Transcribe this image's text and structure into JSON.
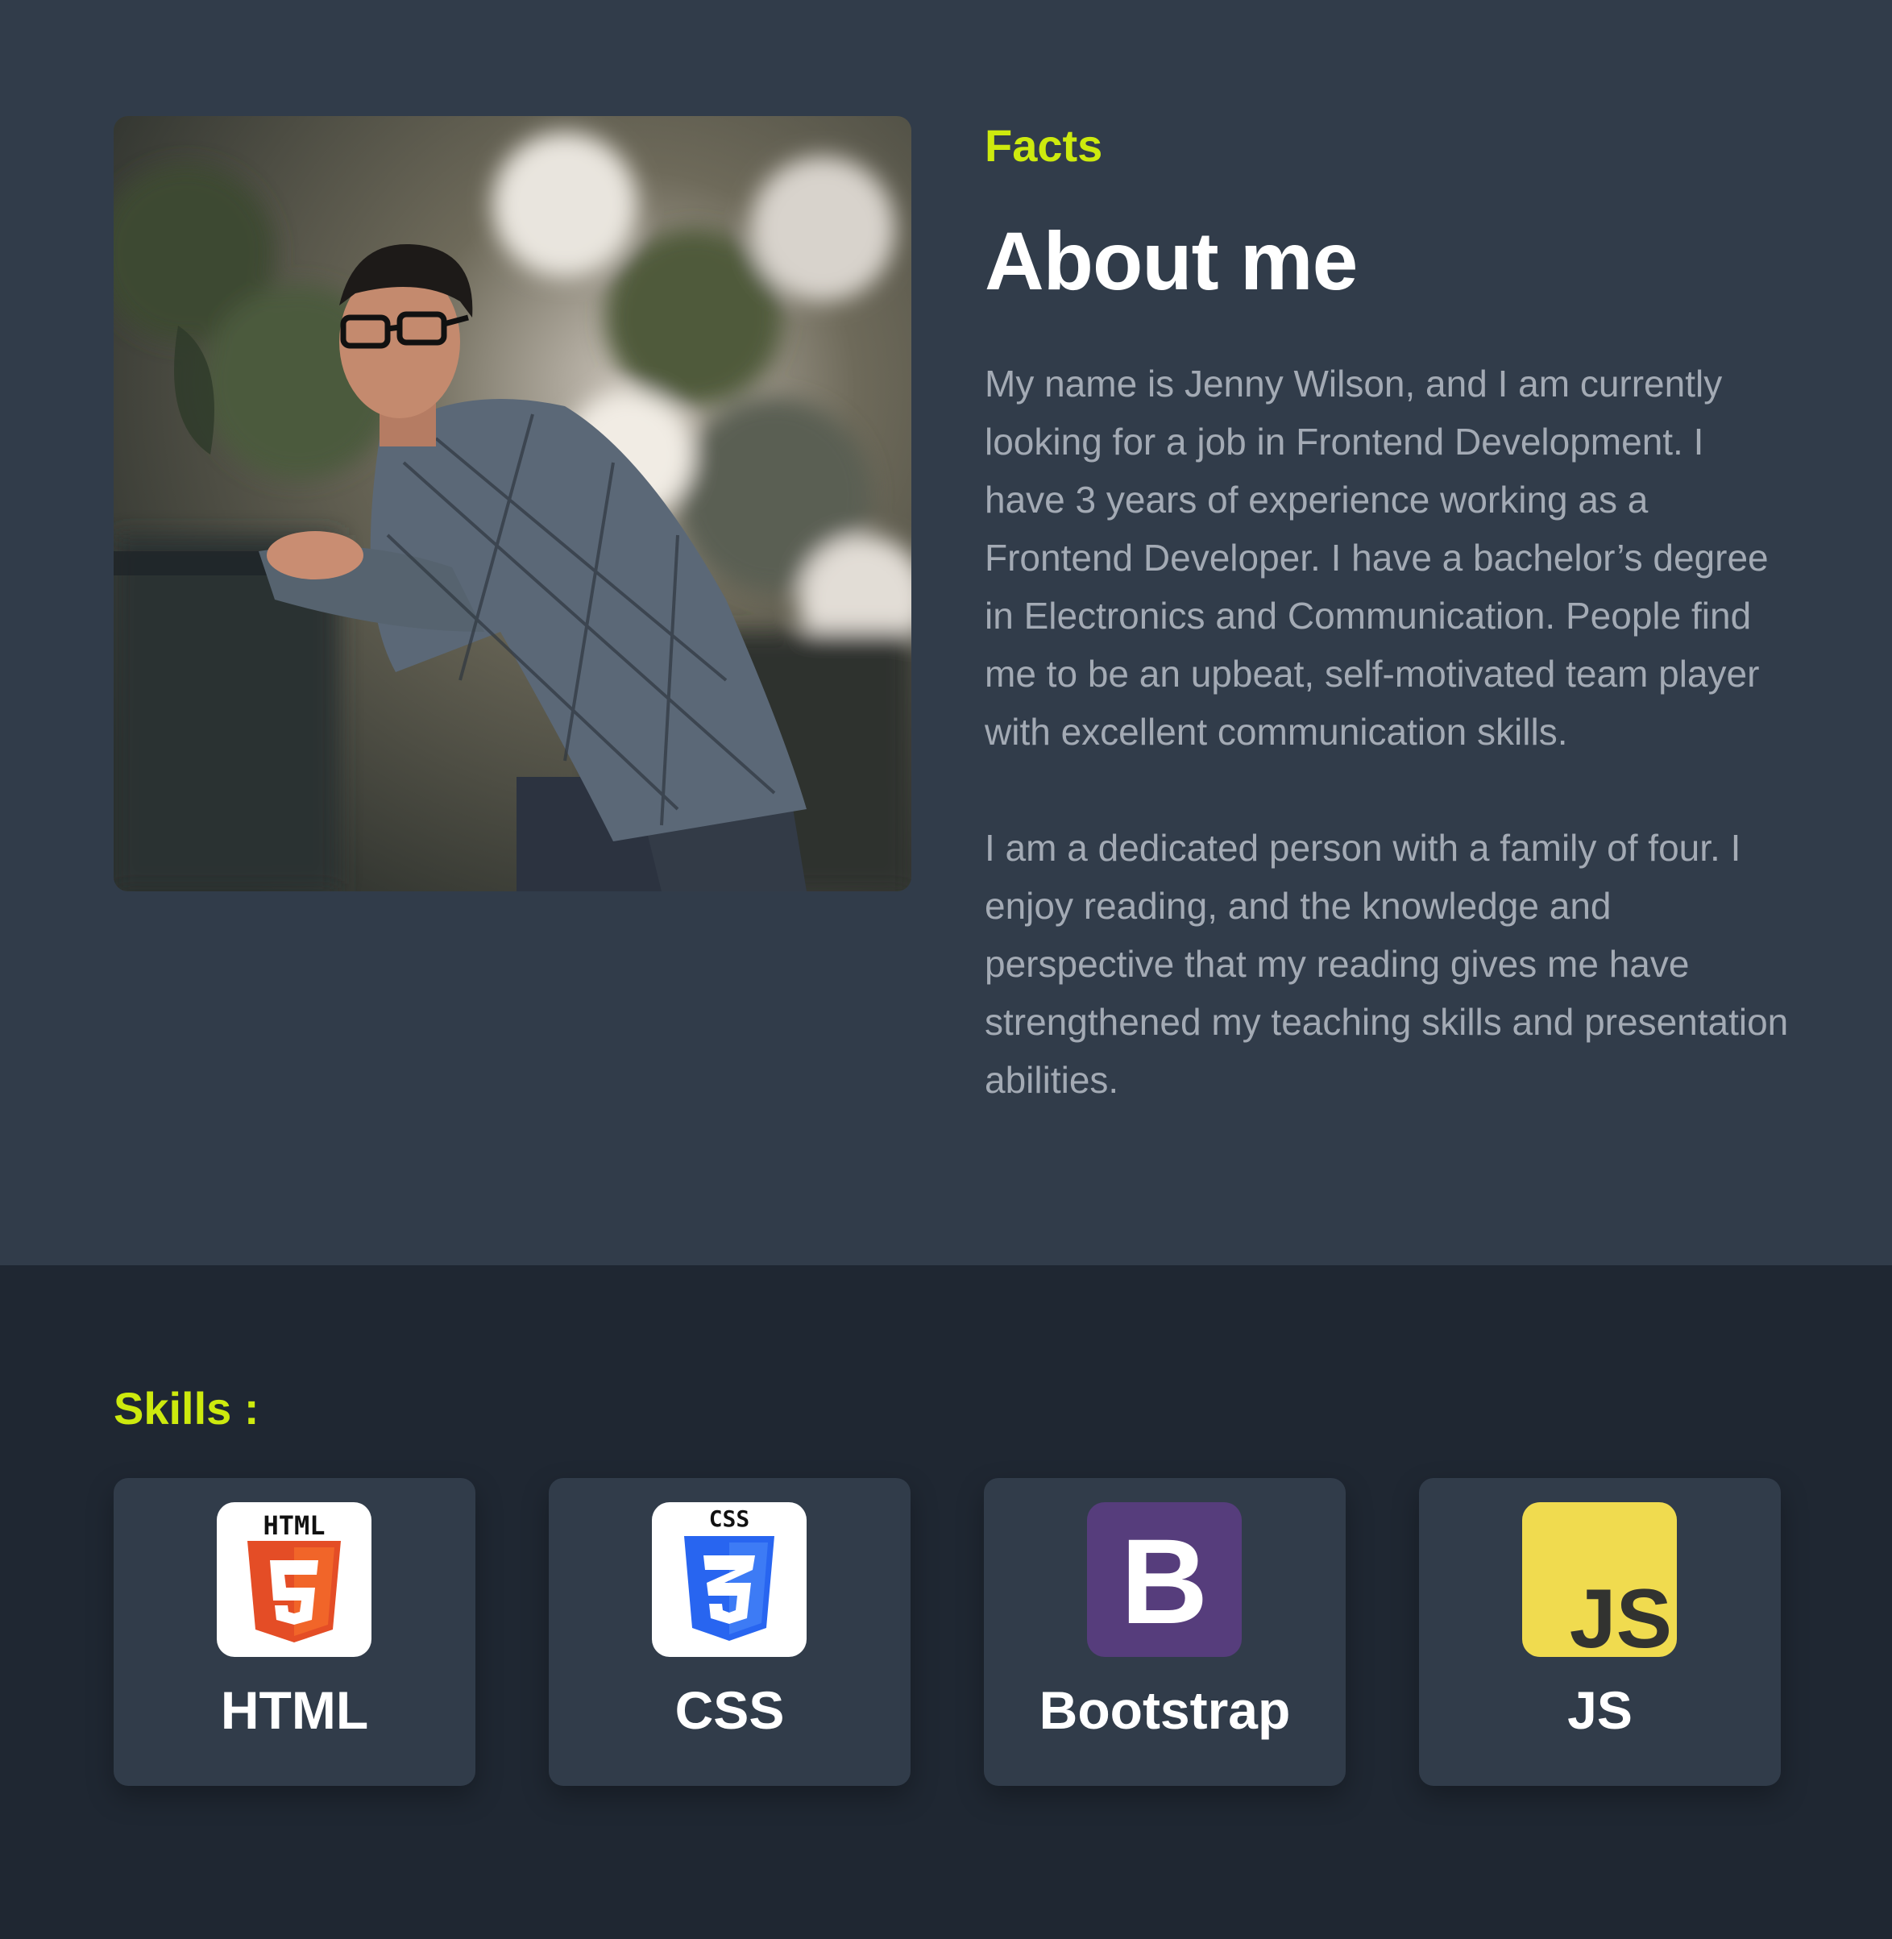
{
  "about": {
    "eyebrow": "Facts",
    "title": "About me",
    "paragraphs": [
      "My name is Jenny Wilson, and I am currently looking for a job in Frontend Development. I have 3 years of experience working as a Frontend Developer. I have a bachelor’s degree in Electronics and Communication. People find me to be an upbeat, self-motivated team player with excellent communication skills.",
      "I am a dedicated person with a family of four. I enjoy reading, and the knowledge and perspective that my reading gives me have strengthened my teaching skills and presentation abilities."
    ],
    "photo_icon": "portrait-photo"
  },
  "skills": {
    "title": "Skills :",
    "items": [
      {
        "label": "HTML",
        "icon": "html5-icon",
        "badge_text": "HTML",
        "glyph": "5",
        "color": "#e44d26"
      },
      {
        "label": "CSS",
        "icon": "css3-icon",
        "badge_text": "CSS",
        "glyph": "3",
        "color": "#2865f0"
      },
      {
        "label": "Bootstrap",
        "icon": "bootstrap-icon",
        "glyph": "B",
        "color": "#563d7c"
      },
      {
        "label": "JS",
        "icon": "javascript-icon",
        "glyph": "JS",
        "color": "#f0db4f"
      }
    ]
  },
  "colors": {
    "accent": "#cdea0e",
    "section_bg": "#313c4a",
    "page_bg": "#1f2732",
    "body_text": "#a3aab4"
  }
}
